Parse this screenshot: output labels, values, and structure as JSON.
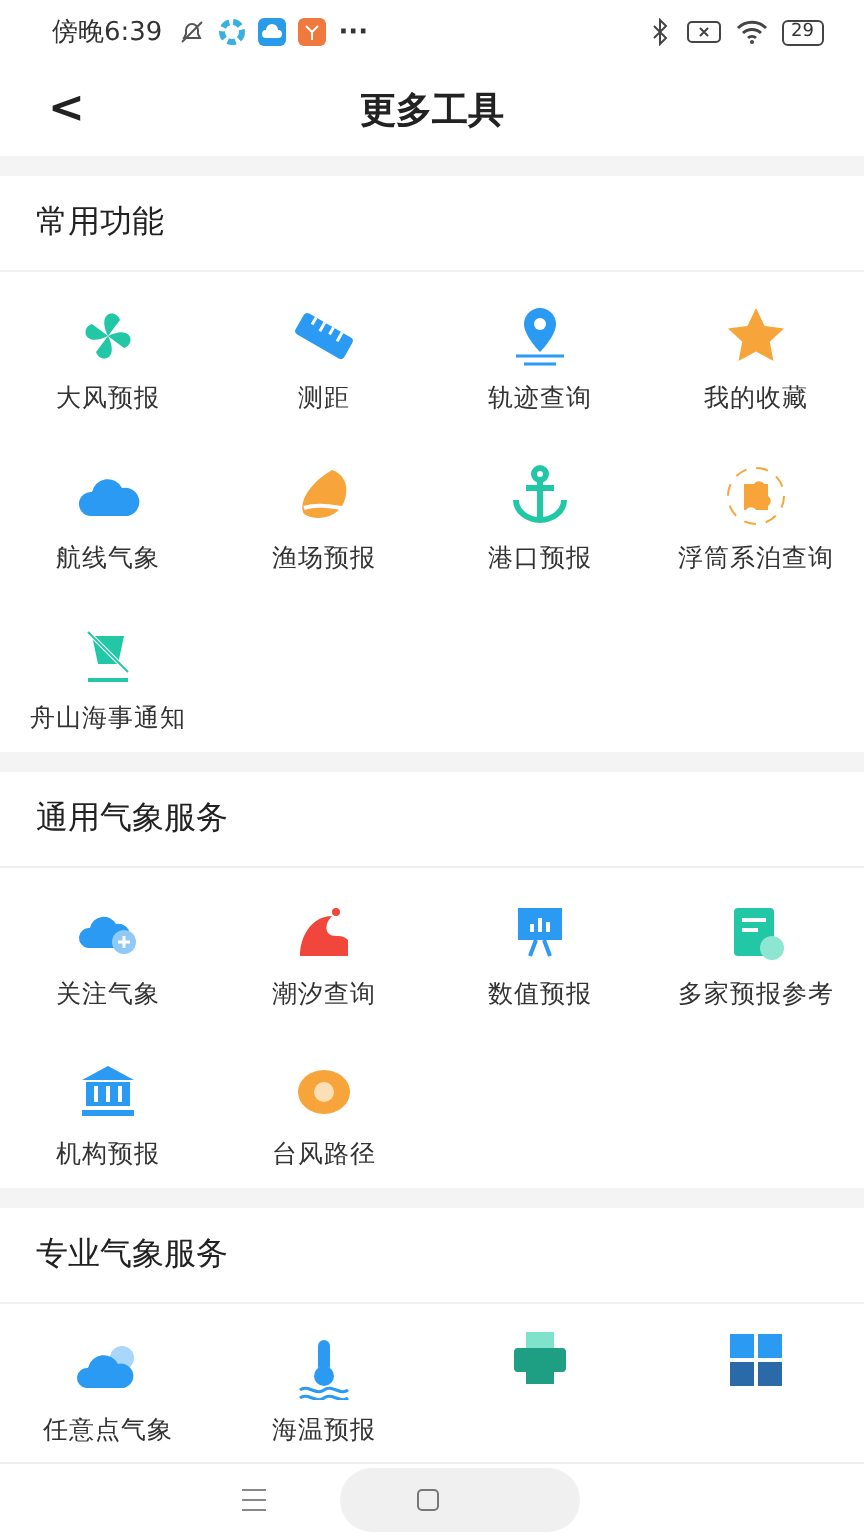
{
  "status_bar": {
    "time": "傍晚6:39",
    "more": "···",
    "battery": "29"
  },
  "header": {
    "back": "<",
    "title": "更多工具"
  },
  "sections": [
    {
      "title": "常用功能",
      "items": [
        {
          "label": "大风预报"
        },
        {
          "label": "测距"
        },
        {
          "label": "轨迹查询"
        },
        {
          "label": "我的收藏"
        },
        {
          "label": "航线气象"
        },
        {
          "label": "渔场预报"
        },
        {
          "label": "港口预报"
        },
        {
          "label": "浮筒系泊查询"
        },
        {
          "label": "舟山海事通知"
        }
      ]
    },
    {
      "title": "通用气象服务",
      "items": [
        {
          "label": "关注气象"
        },
        {
          "label": "潮汐查询"
        },
        {
          "label": "数值预报"
        },
        {
          "label": "多家预报参考"
        },
        {
          "label": "机构预报"
        },
        {
          "label": "台风路径"
        }
      ]
    },
    {
      "title": "专业气象服务",
      "items": [
        {
          "label": "任意点气象"
        },
        {
          "label": "海温预报"
        },
        {
          "kind": "icon-only"
        },
        {
          "kind": "icon-only"
        }
      ]
    }
  ]
}
